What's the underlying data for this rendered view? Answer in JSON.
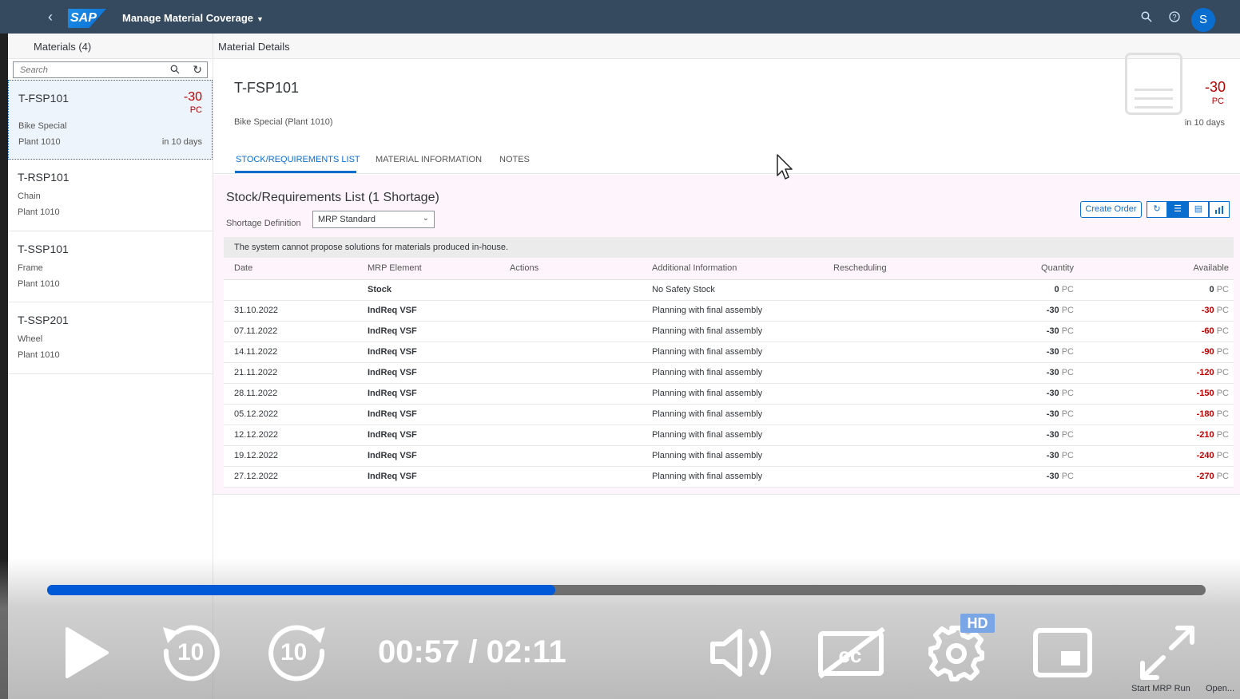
{
  "shell": {
    "logo_text": "SAP",
    "app_title": "Manage Material Coverage",
    "avatar_initial": "S"
  },
  "master": {
    "header": "Materials (4)",
    "search_placeholder": "Search",
    "items": [
      {
        "id": "T-FSP101",
        "name": "Bike Special",
        "plant": "Plant 1010",
        "value": "-30",
        "unit": "PC",
        "days": "in 10 days"
      },
      {
        "id": "T-RSP101",
        "name": "Chain",
        "plant": "Plant 1010"
      },
      {
        "id": "T-SSP101",
        "name": "Frame",
        "plant": "Plant 1010"
      },
      {
        "id": "T-SSP201",
        "name": "Wheel",
        "plant": "Plant 1010"
      }
    ]
  },
  "detail": {
    "header": "Material Details",
    "title": "T-FSP101",
    "subtitle": "Bike Special (Plant 1010)",
    "value": "-30",
    "unit": "PC",
    "days": "in 10 days",
    "tabs": [
      "STOCK/REQUIREMENTS LIST",
      "MATERIAL INFORMATION",
      "NOTES"
    ],
    "section_title": "Stock/Requirements List (1 Shortage)",
    "shortage_label": "Shortage Definition",
    "shortage_value": "MRP Standard",
    "create_order": "Create Order",
    "info_message": "The system cannot propose solutions for materials produced in-house.",
    "columns": [
      "Date",
      "MRP Element",
      "Actions",
      "Additional Information",
      "Rescheduling",
      "Quantity",
      "Available"
    ],
    "rows": [
      {
        "date": "",
        "element": "Stock",
        "info": "No Safety Stock",
        "qty": "0",
        "avail": "0",
        "neg": false
      },
      {
        "date": "31.10.2022",
        "element": "IndReq VSF",
        "info": "Planning with final assembly",
        "qty": "-30",
        "avail": "-30",
        "neg": true
      },
      {
        "date": "07.11.2022",
        "element": "IndReq VSF",
        "info": "Planning with final assembly",
        "qty": "-30",
        "avail": "-60",
        "neg": true
      },
      {
        "date": "14.11.2022",
        "element": "IndReq VSF",
        "info": "Planning with final assembly",
        "qty": "-30",
        "avail": "-90",
        "neg": true
      },
      {
        "date": "21.11.2022",
        "element": "IndReq VSF",
        "info": "Planning with final assembly",
        "qty": "-30",
        "avail": "-120",
        "neg": true
      },
      {
        "date": "28.11.2022",
        "element": "IndReq VSF",
        "info": "Planning with final assembly",
        "qty": "-30",
        "avail": "-150",
        "neg": true
      },
      {
        "date": "05.12.2022",
        "element": "IndReq VSF",
        "info": "Planning with final assembly",
        "qty": "-30",
        "avail": "-180",
        "neg": true
      },
      {
        "date": "12.12.2022",
        "element": "IndReq VSF",
        "info": "Planning with final assembly",
        "qty": "-30",
        "avail": "-210",
        "neg": true
      },
      {
        "date": "19.12.2022",
        "element": "IndReq VSF",
        "info": "Planning with final assembly",
        "qty": "-30",
        "avail": "-240",
        "neg": true
      },
      {
        "date": "27.12.2022",
        "element": "IndReq VSF",
        "info": "Planning with final assembly",
        "qty": "-30",
        "avail": "-270",
        "neg": true
      }
    ],
    "unit_label": "PC"
  },
  "footer": {
    "start_mrp": "Start MRP Run",
    "open": "Open..."
  },
  "video": {
    "time": "00:57 / 02:11",
    "progress": 0.4386,
    "skip_seconds": "10",
    "hd_label": "HD"
  },
  "colors": {
    "shell": "#354a5f",
    "accent": "#0a6ed1",
    "negative": "#bb0000",
    "progress": "#0059d6"
  }
}
